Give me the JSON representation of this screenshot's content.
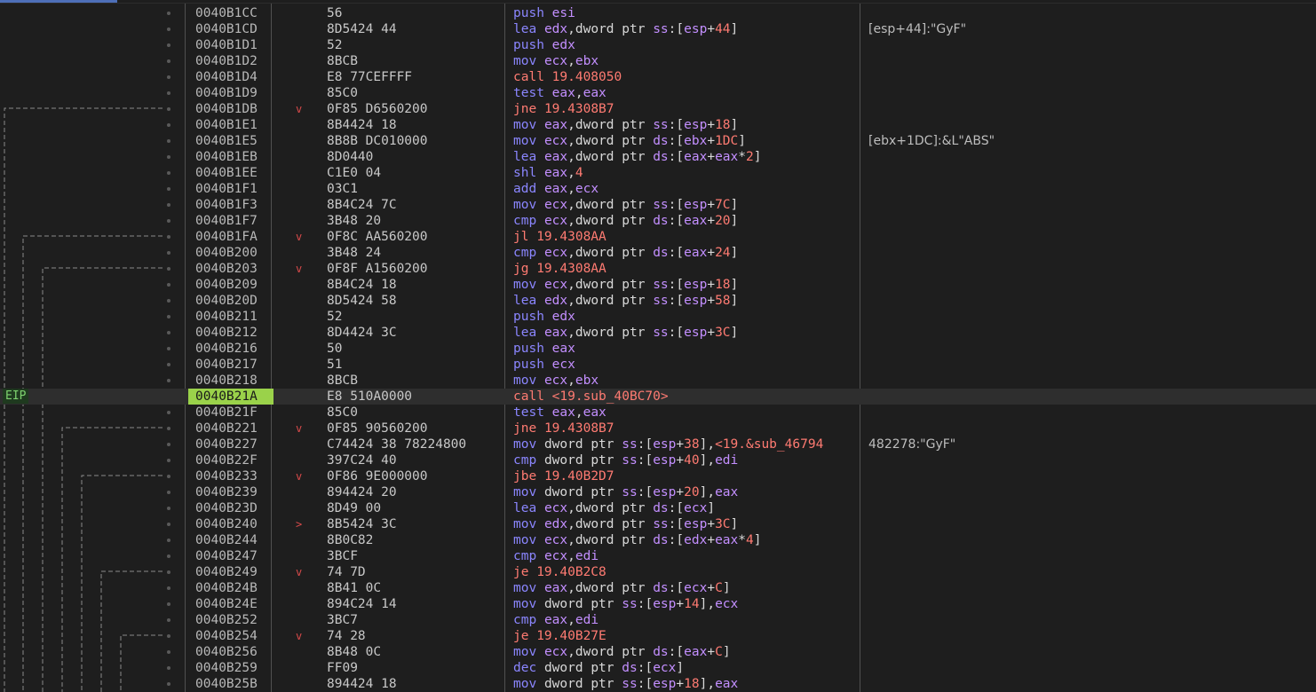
{
  "eip_label": "EIP",
  "colors": {
    "mnemonic": "#8b86ff",
    "jump": "#ff7b72",
    "register": "#c38fff",
    "eip_highlight": "#9ad24a",
    "branch_marker": "#d84a4a",
    "background": "#1e1e1e"
  },
  "rows": [
    {
      "addr": "0040B1CC",
      "bytes": "56",
      "disasm": "push esi",
      "comment": ""
    },
    {
      "addr": "0040B1CD",
      "bytes": "8D5424 44",
      "disasm": "lea edx,dword ptr ss:[esp+44]",
      "comment": "[esp+44]:\"GyF\""
    },
    {
      "addr": "0040B1D1",
      "bytes": "52",
      "disasm": "push edx",
      "comment": ""
    },
    {
      "addr": "0040B1D2",
      "bytes": "8BCB",
      "disasm": "mov ecx,ebx",
      "comment": ""
    },
    {
      "addr": "0040B1D4",
      "bytes": "E8 77CEFFFF",
      "disasm": "call 19.408050",
      "comment": ""
    },
    {
      "addr": "0040B1D9",
      "bytes": "85C0",
      "disasm": "test eax,eax",
      "comment": ""
    },
    {
      "addr": "0040B1DB",
      "bytes": "0F85 D6560200",
      "disasm": "jne 19.4308B7",
      "comment": "",
      "marker": "v"
    },
    {
      "addr": "0040B1E1",
      "bytes": "8B4424 18",
      "disasm": "mov eax,dword ptr ss:[esp+18]",
      "comment": ""
    },
    {
      "addr": "0040B1E5",
      "bytes": "8B8B DC010000",
      "disasm": "mov ecx,dword ptr ds:[ebx+1DC]",
      "comment": "[ebx+1DC]:&L\"ABS\""
    },
    {
      "addr": "0040B1EB",
      "bytes": "8D0440",
      "disasm": "lea eax,dword ptr ds:[eax+eax*2]",
      "comment": ""
    },
    {
      "addr": "0040B1EE",
      "bytes": "C1E0 04",
      "disasm": "shl eax,4",
      "comment": ""
    },
    {
      "addr": "0040B1F1",
      "bytes": "03C1",
      "disasm": "add eax,ecx",
      "comment": ""
    },
    {
      "addr": "0040B1F3",
      "bytes": "8B4C24 7C",
      "disasm": "mov ecx,dword ptr ss:[esp+7C]",
      "comment": ""
    },
    {
      "addr": "0040B1F7",
      "bytes": "3B48 20",
      "disasm": "cmp ecx,dword ptr ds:[eax+20]",
      "comment": ""
    },
    {
      "addr": "0040B1FA",
      "bytes": "0F8C AA560200",
      "disasm": "jl 19.4308AA",
      "comment": "",
      "marker": "v"
    },
    {
      "addr": "0040B200",
      "bytes": "3B48 24",
      "disasm": "cmp ecx,dword ptr ds:[eax+24]",
      "comment": ""
    },
    {
      "addr": "0040B203",
      "bytes": "0F8F A1560200",
      "disasm": "jg 19.4308AA",
      "comment": "",
      "marker": "v"
    },
    {
      "addr": "0040B209",
      "bytes": "8B4C24 18",
      "disasm": "mov ecx,dword ptr ss:[esp+18]",
      "comment": ""
    },
    {
      "addr": "0040B20D",
      "bytes": "8D5424 58",
      "disasm": "lea edx,dword ptr ss:[esp+58]",
      "comment": ""
    },
    {
      "addr": "0040B211",
      "bytes": "52",
      "disasm": "push edx",
      "comment": ""
    },
    {
      "addr": "0040B212",
      "bytes": "8D4424 3C",
      "disasm": "lea eax,dword ptr ss:[esp+3C]",
      "comment": ""
    },
    {
      "addr": "0040B216",
      "bytes": "50",
      "disasm": "push eax",
      "comment": ""
    },
    {
      "addr": "0040B217",
      "bytes": "51",
      "disasm": "push ecx",
      "comment": ""
    },
    {
      "addr": "0040B218",
      "bytes": "8BCB",
      "disasm": "mov ecx,ebx",
      "comment": ""
    },
    {
      "addr": "0040B21A",
      "bytes": "E8 510A0000",
      "disasm": "call <19.sub_40BC70>",
      "comment": "",
      "eip": true
    },
    {
      "addr": "0040B21F",
      "bytes": "85C0",
      "disasm": "test eax,eax",
      "comment": ""
    },
    {
      "addr": "0040B221",
      "bytes": "0F85 90560200",
      "disasm": "jne 19.4308B7",
      "comment": "",
      "marker": "v"
    },
    {
      "addr": "0040B227",
      "bytes": "C74424 38 78224800",
      "disasm": "mov dword ptr ss:[esp+38],<19.&sub_46794",
      "comment": "482278:\"GyF\""
    },
    {
      "addr": "0040B22F",
      "bytes": "397C24 40",
      "disasm": "cmp dword ptr ss:[esp+40],edi",
      "comment": ""
    },
    {
      "addr": "0040B233",
      "bytes": "0F86 9E000000",
      "disasm": "jbe 19.40B2D7",
      "comment": "",
      "marker": "v"
    },
    {
      "addr": "0040B239",
      "bytes": "894424 20",
      "disasm": "mov dword ptr ss:[esp+20],eax",
      "comment": ""
    },
    {
      "addr": "0040B23D",
      "bytes": "8D49 00",
      "disasm": "lea ecx,dword ptr ds:[ecx]",
      "comment": ""
    },
    {
      "addr": "0040B240",
      "bytes": "8B5424 3C",
      "disasm": "mov edx,dword ptr ss:[esp+3C]",
      "comment": "",
      "marker": ">"
    },
    {
      "addr": "0040B244",
      "bytes": "8B0C82",
      "disasm": "mov ecx,dword ptr ds:[edx+eax*4]",
      "comment": ""
    },
    {
      "addr": "0040B247",
      "bytes": "3BCF",
      "disasm": "cmp ecx,edi",
      "comment": ""
    },
    {
      "addr": "0040B249",
      "bytes": "74 7D",
      "disasm": "je 19.40B2C8",
      "comment": "",
      "marker": "v"
    },
    {
      "addr": "0040B24B",
      "bytes": "8B41 0C",
      "disasm": "mov eax,dword ptr ds:[ecx+C]",
      "comment": ""
    },
    {
      "addr": "0040B24E",
      "bytes": "894C24 14",
      "disasm": "mov dword ptr ss:[esp+14],ecx",
      "comment": ""
    },
    {
      "addr": "0040B252",
      "bytes": "3BC7",
      "disasm": "cmp eax,edi",
      "comment": ""
    },
    {
      "addr": "0040B254",
      "bytes": "74 28",
      "disasm": "je 19.40B27E",
      "comment": "",
      "marker": "v"
    },
    {
      "addr": "0040B256",
      "bytes": "8B48 0C",
      "disasm": "mov ecx,dword ptr ds:[eax+C]",
      "comment": ""
    },
    {
      "addr": "0040B259",
      "bytes": "FF09",
      "disasm": "dec dword ptr ds:[ecx]",
      "comment": ""
    },
    {
      "addr": "0040B25B",
      "bytes": "894424 18",
      "disasm": "mov dword ptr ss:[esp+18],eax",
      "comment": ""
    }
  ]
}
